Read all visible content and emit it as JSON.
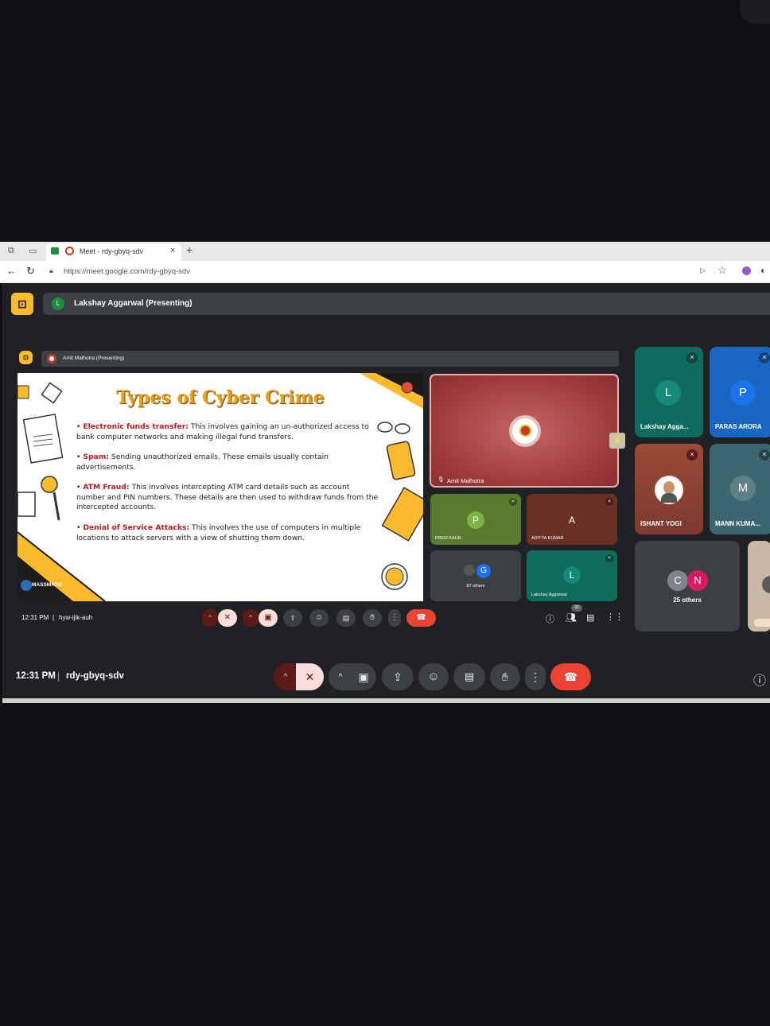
{
  "browser": {
    "tab_title": "Meet - rdy-gbyq-sdv",
    "tab_close": "×",
    "new_tab": "+",
    "url": "https://meet.google.com/rdy-gbyq-sdv"
  },
  "outer_meet": {
    "presenter_initial": "L",
    "presenter_label": "Lakshay Aggarwal (Presenting)",
    "time": "12:31 PM",
    "separator": "|",
    "meeting_code": "rdy-gbyq-sdv"
  },
  "inner_meet": {
    "presenter_label": "Amit Malhotra (Presenting)",
    "time": "12:31 PM",
    "separator": "|",
    "meeting_code": "hyw-ijik-auh",
    "participant_badge": "92"
  },
  "slide": {
    "title": "Types of Cyber Crime",
    "bullets": [
      {
        "term": "Electronic funds transfer:",
        "text": " This involves gaining an un-authorized access to bank computer networks and making illegal fund transfers."
      },
      {
        "term": "Spam:",
        "text": " Sending unauthorized emails. These emails usually contain advertisements."
      },
      {
        "term": "ATM Fraud:",
        "text": " This involves intercepting ATM card details such as account number and PIN numbers. These details are then used to withdraw funds from the intercepted accounts."
      },
      {
        "term": "Denial of Service Attacks:",
        "text": " This involves the use of computers in multiple locations to attack servers with a view of shutting them down."
      }
    ],
    "logo_text": "MASSMATIC"
  },
  "inner_tiles": {
    "main_speaker": "Amit Malhotra",
    "prem": {
      "initial": "P",
      "name": "PREM KAUR"
    },
    "aditya": {
      "initial": "A",
      "name": "ADITYA KUMAR"
    },
    "others": {
      "initial": "G",
      "label": "87 others"
    },
    "lakshay": {
      "initial": "L",
      "name": "Lakshay Aggarwal"
    }
  },
  "outer_tiles": {
    "lakshay": {
      "initial": "L",
      "name": "Lakshay Agga..."
    },
    "paras": {
      "initial": "P",
      "name": "PARAS ARORA"
    },
    "ishant": {
      "name": "ISHANT YOGI"
    },
    "mann": {
      "initial": "M",
      "name": "MANN KUMA..."
    },
    "others": {
      "initial_1": "C",
      "initial_2": "N",
      "label": "25 others"
    }
  },
  "colors": {
    "meet_bg": "#202124",
    "control": "#3c4043",
    "end_call": "#ea4335",
    "accent_yellow": "#f9bb2d",
    "slide_title": "#e8a01a",
    "bullet_term": "#c8161d"
  },
  "icons": [
    "tab-actions-icon",
    "back-icon",
    "reload-icon",
    "star-icon",
    "mic-off-icon",
    "camera-icon",
    "present-icon",
    "emoji-icon",
    "captions-icon",
    "raise-hand-icon",
    "more-icon",
    "end-call-icon",
    "info-icon",
    "people-icon",
    "chat-icon",
    "activities-icon"
  ]
}
